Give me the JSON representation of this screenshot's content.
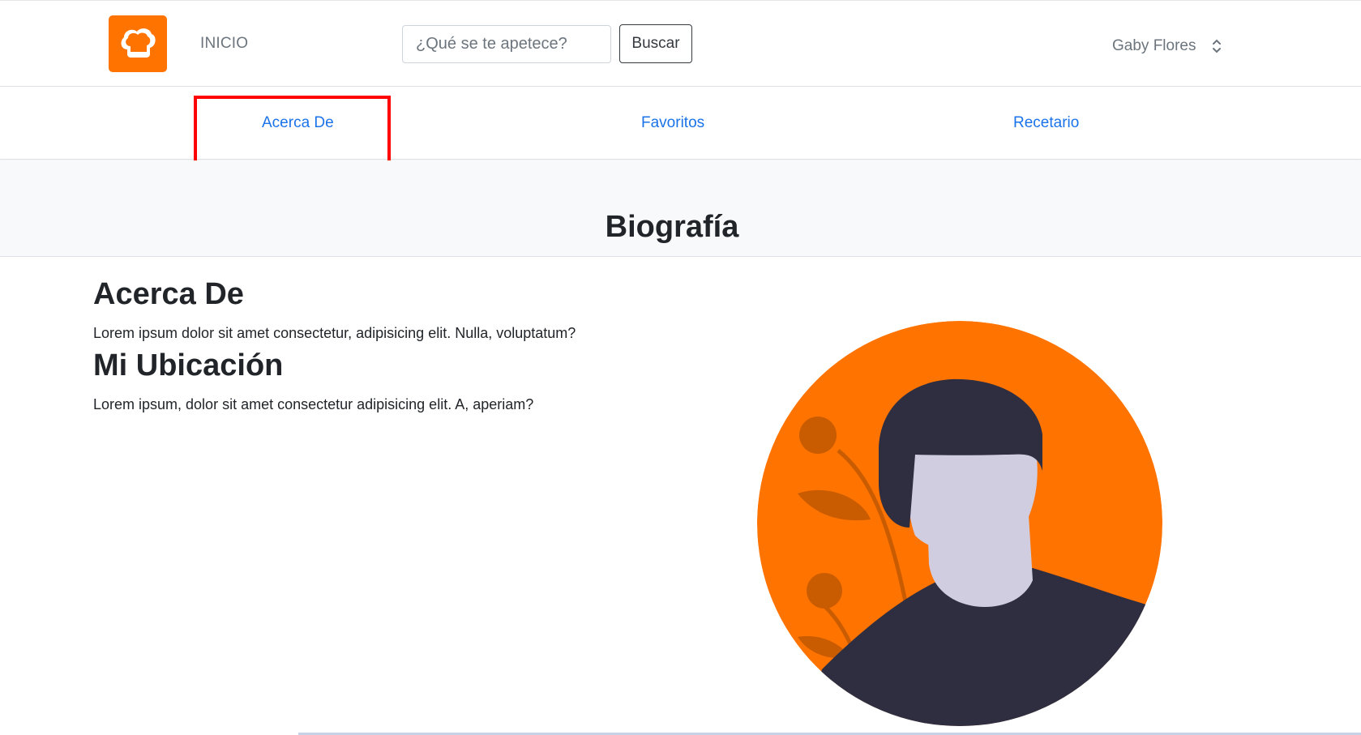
{
  "header": {
    "home_link": "INICIO",
    "search": {
      "placeholder": "¿Qué se te apetece?",
      "value": ""
    },
    "search_button": "Buscar",
    "user": {
      "name": "Gaby Flores"
    }
  },
  "subnav": {
    "items": [
      {
        "label": "Acerca De",
        "highlighted": true
      },
      {
        "label": "Favoritos"
      },
      {
        "label": "Recetario"
      }
    ]
  },
  "page_title": "Biografía",
  "sections": {
    "about": {
      "title": "Acerca De",
      "text": "Lorem ipsum dolor sit amet consectetur, adipisicing elit. Nulla, voluptatum?"
    },
    "location": {
      "title": "Mi Ubicación",
      "text": "Lorem ipsum, dolor sit amet consectetur adipisicing elit. A, aperiam?"
    }
  },
  "icons": {
    "logo": "chef-hat-icon",
    "user_menu": "chevron-up-down-icon",
    "avatar": "user-avatar-illustration"
  },
  "colors": {
    "brand": "#ff7300",
    "link": "#1a73e8",
    "highlight": "#ff0000",
    "avatar_dark": "#2f2e41",
    "avatar_skin": "#d0cde1",
    "avatar_accent": "#c95b00"
  }
}
